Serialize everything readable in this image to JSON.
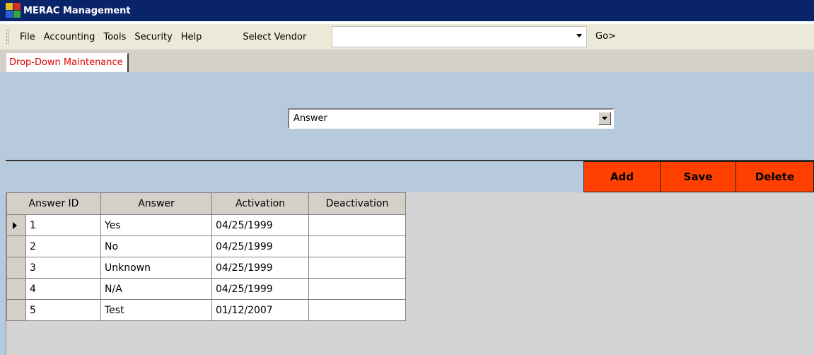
{
  "window": {
    "title": "MERAC Management"
  },
  "menu": {
    "items": [
      "File",
      "Accounting",
      "Tools",
      "Security",
      "Help"
    ],
    "vendor_label": "Select Vendor",
    "vendor_value": "",
    "go_label": "Go>"
  },
  "tabs": [
    {
      "label": "Drop-Down Maintenance",
      "active": true
    }
  ],
  "dropdown": {
    "selected": "Answer"
  },
  "actions": {
    "add": "Add",
    "save": "Save",
    "delete": "Delete",
    "color": "#ff4000"
  },
  "grid": {
    "columns": [
      "Answer ID",
      "Answer",
      "Activation",
      "Deactivation"
    ],
    "current_row": 0,
    "rows": [
      {
        "id": "1",
        "answer": "Yes",
        "activation": "04/25/1999",
        "deactivation": ""
      },
      {
        "id": "2",
        "answer": "No",
        "activation": "04/25/1999",
        "deactivation": ""
      },
      {
        "id": "3",
        "answer": "Unknown",
        "activation": "04/25/1999",
        "deactivation": ""
      },
      {
        "id": "4",
        "answer": "N/A",
        "activation": "04/25/1999",
        "deactivation": ""
      },
      {
        "id": "5",
        "answer": "Test",
        "activation": "01/12/2007",
        "deactivation": ""
      }
    ]
  },
  "icons": {
    "app": "app-icon",
    "current_row": "row-pointer-icon",
    "dropdown": "chevron-down-icon"
  }
}
